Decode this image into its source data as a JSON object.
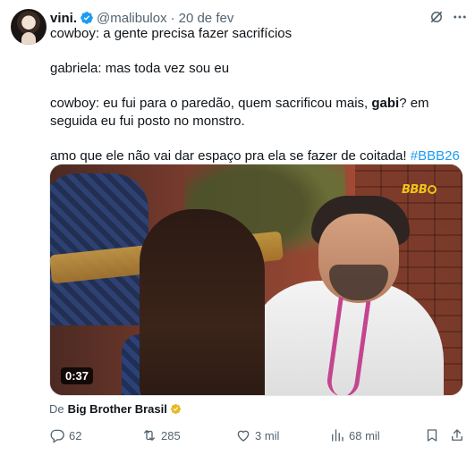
{
  "author": {
    "display_name": "vini.",
    "handle": "@malibulox",
    "separator": "·",
    "date": "20 de fev",
    "verified": true
  },
  "text": {
    "line1": "cowboy: a gente precisa fazer sacrifícios",
    "line2": "gabriela: mas toda vez sou eu",
    "line3_before": "cowboy: eu fui para o paredão, quem sacrificou mais, ",
    "line3_bold": "gabi",
    "line3_after": "? em seguida eu fui posto no monstro.",
    "line4_before": "amo que ele não vai dar espaço pra ela se fazer de coitada! ",
    "hashtag": "#BBB26"
  },
  "media": {
    "watermark": "BBB",
    "duration": "0:37"
  },
  "source": {
    "prefix": "De",
    "name": "Big Brother Brasil"
  },
  "actions": {
    "replies": "62",
    "retweets": "285",
    "likes": "3 mil",
    "views": "68 mil"
  },
  "colors": {
    "accent": "#1d9bf0",
    "muted": "#536471",
    "text": "#0f1419",
    "gold_badge": "#e8b923"
  },
  "icons": [
    "verified-badge-icon",
    "grok-icon",
    "more-icon",
    "reply-icon",
    "retweet-icon",
    "like-icon",
    "views-icon",
    "bookmark-icon",
    "share-icon",
    "gold-verified-badge-icon"
  ]
}
